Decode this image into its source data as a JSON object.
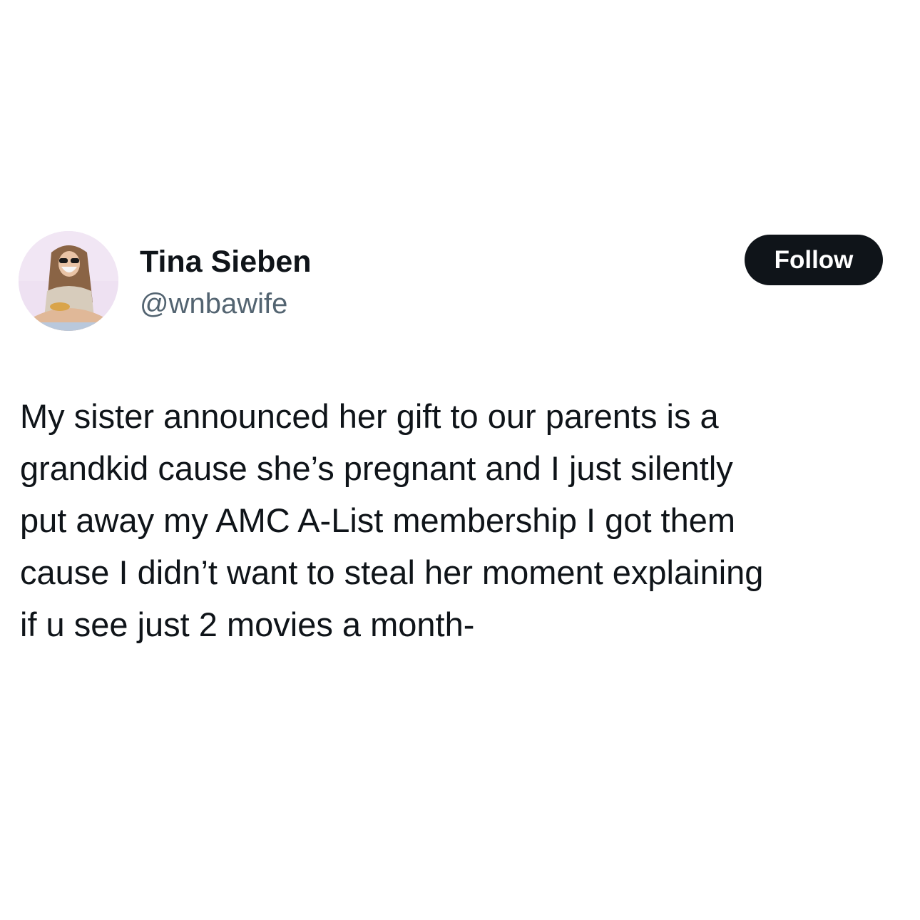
{
  "author": {
    "display_name": "Tina Sieben",
    "handle": "@wnbawife",
    "avatar_icon": "profile-photo"
  },
  "follow_button": {
    "label": "Follow"
  },
  "tweet": {
    "lines": [
      "My sister announced her gift to our parents is a",
      "grandkid cause she’s pregnant and I just silently",
      "put away my AMC A-List membership I got them",
      "cause I didn’t want to steal her moment explaining",
      "if u see just 2 movies a month-"
    ]
  },
  "colors": {
    "text_primary": "#0f1419",
    "text_secondary": "#536471",
    "button_bg": "#0f1419",
    "button_text": "#ffffff",
    "background": "#ffffff"
  }
}
